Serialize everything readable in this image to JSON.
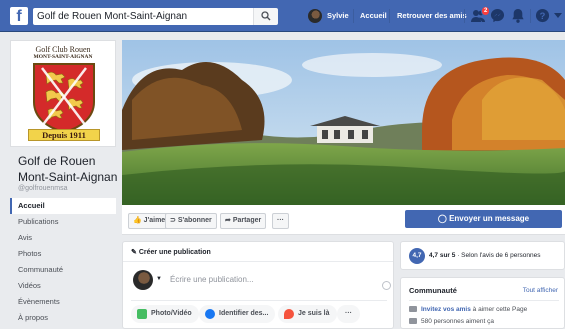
{
  "topbar": {
    "logo": "f",
    "search_value": "Golf de Rouen Mont-Saint-Aignan",
    "user_name": "Sylvie",
    "home": "Accueil",
    "find_friends": "Retrouver des amis",
    "friend_requests_badge": "2",
    "icons": [
      "search-icon",
      "friends-icon",
      "messenger-icon",
      "bell-icon",
      "help-icon",
      "caret-down-icon"
    ]
  },
  "logo": {
    "line1": "Golf Club Rouen",
    "line2": "MONT-SAINT-AIGNAN",
    "banner": "Depuis 1911"
  },
  "page": {
    "name": "Golf de Rouen Mont-Saint-Aignan",
    "handle": "@golfrouenmsa"
  },
  "menu": [
    {
      "label": "Accueil",
      "active": true
    },
    {
      "label": "Publications"
    },
    {
      "label": "Avis"
    },
    {
      "label": "Photos"
    },
    {
      "label": "Communauté"
    },
    {
      "label": "Vidéos"
    },
    {
      "label": "Évènements"
    },
    {
      "label": "À propos"
    }
  ],
  "actions": {
    "like": "J'aime",
    "follow": "S'abonner",
    "share": "Partager",
    "more": "···",
    "message": "Envoyer un message"
  },
  "post": {
    "header": "Créer une publication",
    "placeholder": "Écrire une publication...",
    "photo_video": "Photo/Vidéo",
    "tag": "Identifier des...",
    "checkin": "Je suis là",
    "more": "···"
  },
  "rating": {
    "score": "4,7",
    "text_bold": "4,7 sur 5",
    "text": " · Selon l'avis de 6 personnes"
  },
  "community": {
    "title": "Communauté",
    "see_all": "Tout afficher",
    "invite_link": "Invitez vos amis",
    "invite_rest": " à aimer cette Page",
    "likes": "580 personnes aiment ça"
  },
  "colors": {
    "brand": "#4267b2",
    "badge": "#fa3e3e",
    "background": "#e9ebee"
  }
}
